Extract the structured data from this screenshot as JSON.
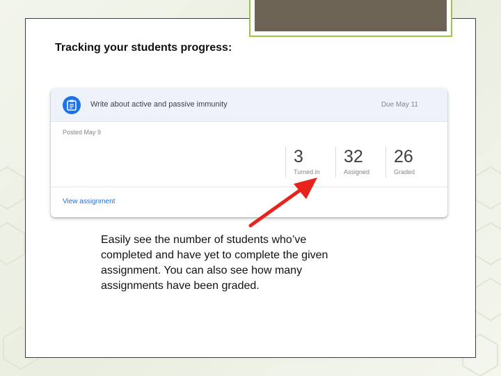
{
  "slide": {
    "title": "Tracking your students progress:",
    "caption": "Easily see the number of students who’ve completed and have yet to complete the given assignment. You can also see how many assignments have been graded."
  },
  "assignment_card": {
    "icon": "assignment-icon",
    "title": "Write about active and passive immunity",
    "due": "Due May 11",
    "posted": "Posted May 9",
    "stats": [
      {
        "value": "3",
        "label": "Turned in"
      },
      {
        "value": "32",
        "label": "Assigned"
      },
      {
        "value": "26",
        "label": "Graded"
      }
    ],
    "view_link": "View assignment"
  },
  "colors": {
    "accent_green": "#9ac73a",
    "google_blue": "#1a73e8",
    "arrow_red": "#e8231d",
    "header_bg": "#eef3fb"
  }
}
